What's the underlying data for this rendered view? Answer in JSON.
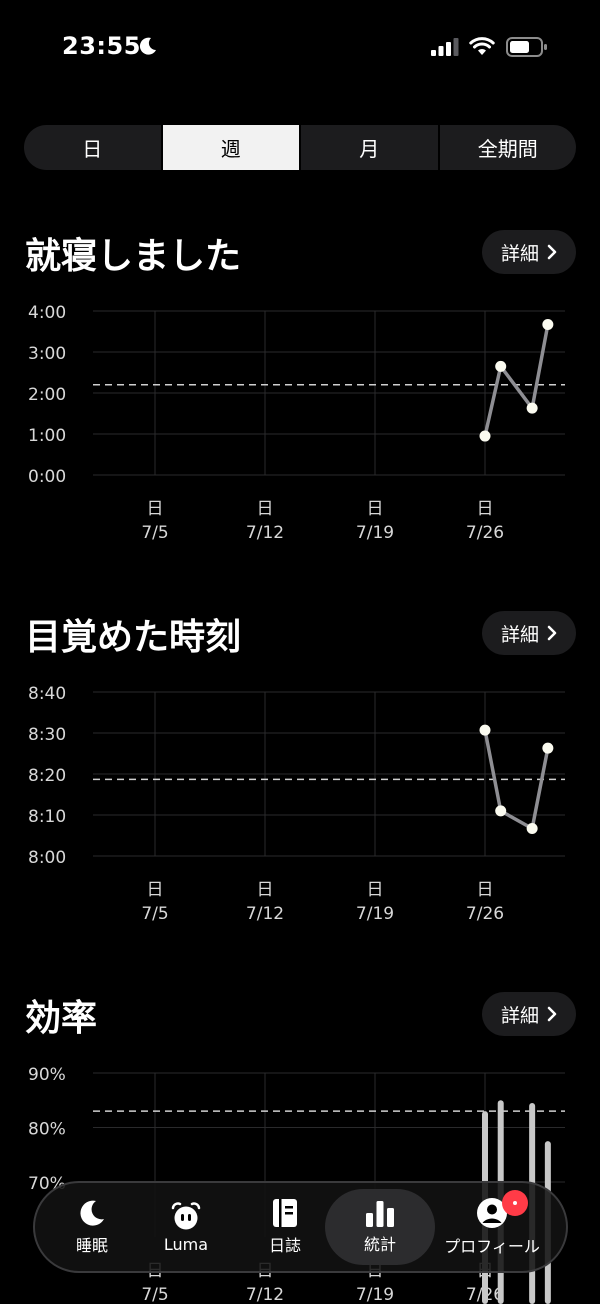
{
  "status_bar": {
    "time": "23:55"
  },
  "segments": [
    {
      "label": "日",
      "active": false
    },
    {
      "label": "週",
      "active": true
    },
    {
      "label": "月",
      "active": false
    },
    {
      "label": "全期間",
      "active": false
    }
  ],
  "sections": {
    "bedtime": {
      "title": "就寝しました",
      "detail_label": "詳細"
    },
    "wake": {
      "title": "目覚めた時刻",
      "detail_label": "詳細"
    },
    "efficiency": {
      "title": "効率",
      "detail_label": "詳細"
    }
  },
  "x_labels": [
    {
      "day": "日",
      "date": "7/5"
    },
    {
      "day": "日",
      "date": "7/12"
    },
    {
      "day": "日",
      "date": "7/19"
    },
    {
      "day": "日",
      "date": "7/26"
    }
  ],
  "chart_data": [
    {
      "type": "line",
      "name": "bedtime",
      "y_ticks": [
        "4:00",
        "3:00",
        "2:00",
        "1:00",
        "0:00"
      ],
      "ylim": [
        0,
        4
      ],
      "y_unit": "hours after midnight",
      "average": 2.2,
      "x_categories": [
        "7/5",
        "7/12",
        "7/19",
        "7/26"
      ],
      "points": [
        {
          "date": "7/26",
          "value": 0.95
        },
        {
          "date": "7/27",
          "value": 2.65
        },
        {
          "date": "7/29",
          "value": 1.63
        },
        {
          "date": "7/30",
          "value": 3.67
        }
      ],
      "grid": true
    },
    {
      "type": "line",
      "name": "wake",
      "y_ticks": [
        "8:40",
        "8:30",
        "8:20",
        "8:10",
        "8:00"
      ],
      "ylim": [
        480,
        520
      ],
      "y_unit": "minutes since midnight",
      "average": 498.7,
      "x_categories": [
        "7/5",
        "7/12",
        "7/19",
        "7/26"
      ],
      "points": [
        {
          "date": "7/26",
          "value": 510.7
        },
        {
          "date": "7/27",
          "value": 491.0
        },
        {
          "date": "7/29",
          "value": 486.7
        },
        {
          "date": "7/30",
          "value": 506.3
        }
      ],
      "grid": true
    },
    {
      "type": "bar",
      "name": "efficiency",
      "y_ticks": [
        "90%",
        "80%",
        "70%"
      ],
      "ylim": [
        60,
        90
      ],
      "average": 83,
      "x_categories": [
        "7/5",
        "7/12",
        "7/19",
        "7/26"
      ],
      "bars": [
        {
          "date": "7/26",
          "value": 83
        },
        {
          "date": "7/27",
          "value": 85
        },
        {
          "date": "7/29",
          "value": 84.5
        },
        {
          "date": "7/30",
          "value": 77.5
        }
      ],
      "grid": true
    }
  ],
  "tabbar": {
    "items": [
      {
        "label": "睡眠",
        "icon": "moon-icon"
      },
      {
        "label": "Luma",
        "icon": "alarm-clock-icon"
      },
      {
        "label": "日誌",
        "icon": "journal-icon"
      },
      {
        "label": "統計",
        "icon": "bar-chart-icon",
        "active": true
      },
      {
        "label": "プロフィール",
        "icon": "profile-icon"
      }
    ]
  },
  "colors": {
    "background": "#000000",
    "card": "#1c1c1e",
    "active_segment": "#f2f2f2",
    "point": "#fbfbf0",
    "line": "#8e8e93",
    "badge": "#ff3b47"
  }
}
